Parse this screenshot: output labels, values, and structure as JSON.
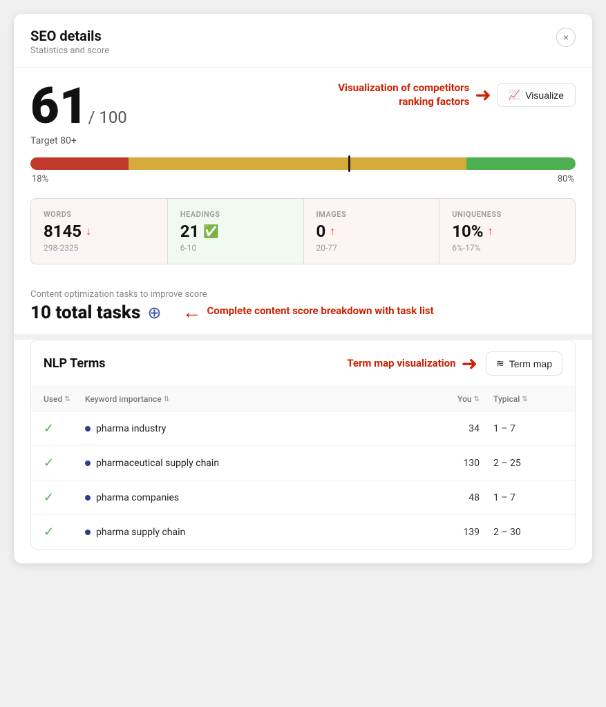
{
  "header": {
    "title": "SEO details",
    "subtitle": "Statistics and score",
    "close_label": "×"
  },
  "score": {
    "value": "61",
    "denominator": "/ 100",
    "target": "Target 80+"
  },
  "visualize_callout": {
    "text": "Visualization of competitors ranking factors",
    "button_label": "Visualize"
  },
  "slider": {
    "left_label": "18%",
    "right_label": "80%"
  },
  "stats": [
    {
      "label": "WORDS",
      "value": "8145",
      "indicator": "down",
      "range": "298-2325",
      "highlight": false
    },
    {
      "label": "HEADINGS",
      "value": "21",
      "indicator": "check",
      "range": "6-10",
      "highlight": true
    },
    {
      "label": "IMAGES",
      "value": "0",
      "indicator": "up",
      "range": "20-77",
      "highlight": false
    },
    {
      "label": "UNIQUENESS",
      "value": "10%",
      "indicator": "up",
      "range": "6%-17%",
      "highlight": false
    }
  ],
  "tasks": {
    "subtitle": "Content optimization tasks to improve score",
    "title": "10 total tasks",
    "callout_text": "Complete content score breakdown with task list"
  },
  "nlp": {
    "title": "NLP Terms",
    "term_map_callout_text": "Term map visualization",
    "term_map_button_label": "Term map",
    "columns": {
      "used": "Used",
      "keyword": "Keyword importance",
      "you": "You",
      "typical": "Typical"
    },
    "rows": [
      {
        "checked": true,
        "term": "pharma industry",
        "you": "34",
        "typical": "1 – 7"
      },
      {
        "checked": true,
        "term": "pharmaceutical supply chain",
        "you": "130",
        "typical": "2 – 25"
      },
      {
        "checked": true,
        "term": "pharma companies",
        "you": "48",
        "typical": "1 – 7"
      },
      {
        "checked": true,
        "term": "pharma supply chain",
        "you": "139",
        "typical": "2 – 30"
      }
    ]
  }
}
